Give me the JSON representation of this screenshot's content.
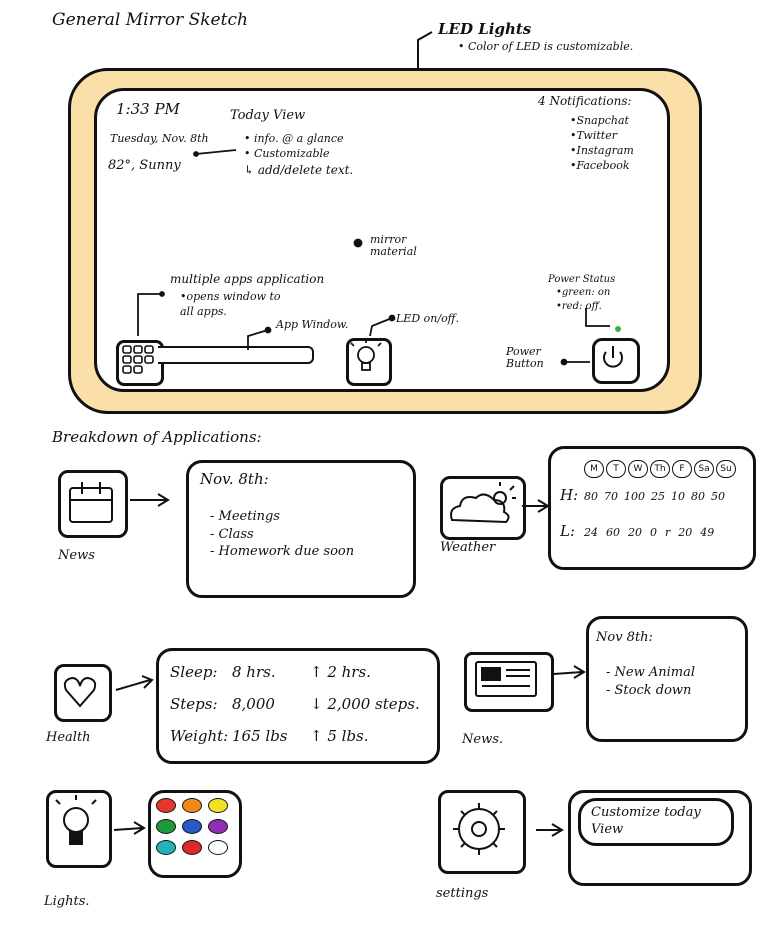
{
  "title": "General Mirror Sketch",
  "led": {
    "label": "LED Lights",
    "note": "• Color of LED is customizable.",
    "frame_color": "#fbdfa8"
  },
  "mirror": {
    "time": "1:33 PM",
    "date": "Tuesday, Nov. 8th",
    "weather": "82°, Sunny",
    "today_view": {
      "title": "Today View",
      "items": [
        "• info. @ a glance",
        "• Customizable",
        "↳ add/delete text."
      ]
    },
    "notifications": {
      "title": "4 Notifications:",
      "items": [
        "•Snapchat",
        "•Twitter",
        "•Instagram",
        "•Facebook"
      ]
    },
    "mirror_material": "mirror material",
    "apps": {
      "title": "multiple apps application",
      "desc": [
        "•opens window to",
        "all apps."
      ]
    },
    "app_window": "App Window.",
    "led_toggle": "LED on/off.",
    "power_status": {
      "title": "Power Status",
      "items": [
        "•green: on",
        "•red: off."
      ],
      "color": "#3cb043"
    },
    "power_button": "Power Button"
  },
  "breakdown": {
    "title": "Breakdown of Applications:",
    "calendar": {
      "label": "News",
      "date": "Nov. 8th:",
      "items": [
        "- Meetings",
        "- Class",
        "- Homework due soon"
      ]
    },
    "weather": {
      "label": "Weather",
      "days": [
        "M",
        "T",
        "W",
        "Th",
        "F",
        "Sa",
        "Su"
      ],
      "high_label": "H:",
      "highs": [
        "80",
        "70",
        "100",
        "25",
        "10",
        "80",
        "50"
      ],
      "low_label": "L:",
      "lows": [
        "24",
        "60",
        "20",
        "0",
        "r",
        "20",
        "49"
      ]
    },
    "health": {
      "label": "Health",
      "rows": [
        {
          "k": "Sleep:",
          "v": "8 hrs.",
          "d": "↑ 2 hrs."
        },
        {
          "k": "Steps:",
          "v": "8,000",
          "d": "↓ 2,000 steps."
        },
        {
          "k": "Weight:",
          "v": "165 lbs",
          "d": "↑ 5 lbs."
        }
      ]
    },
    "news": {
      "label": "News.",
      "date": "Nov 8th:",
      "items": [
        "- New Animal",
        "- Stock down"
      ]
    },
    "lights": {
      "label": "Lights.",
      "swatches": [
        "#e8362a",
        "#f08a1c",
        "#f5e028",
        "#1f9a3a",
        "#2b58c9",
        "#8e2fb5",
        "#21b3b8",
        "#e02828",
        "#ffffff"
      ]
    },
    "settings": {
      "label": "settings",
      "button": "Customize today View"
    }
  }
}
